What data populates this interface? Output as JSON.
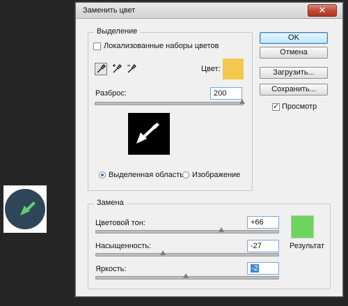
{
  "dialog": {
    "title": "Заменить цвет",
    "close_symbol": "✕"
  },
  "selection": {
    "group_title": "Выделение",
    "localized_clusters_label": "Локализованные наборы цветов",
    "localized_clusters_checked": false,
    "color_label": "Цвет:",
    "color_hex": "#f2c94c",
    "fuzziness_label": "Разброс:",
    "fuzziness_value": "200",
    "fuzziness_level": 1.0,
    "radio_selection_label": "Выделенная область",
    "radio_image_label": "Изображение",
    "radio_selected": "selection"
  },
  "replacement": {
    "group_title": "Замена",
    "hue_label": "Цветовой тон:",
    "hue_value": "+66",
    "hue_level": 0.68,
    "saturation_label": "Насыщенность:",
    "saturation_value": "-27",
    "saturation_level": 0.37,
    "lightness_label": "Яркость:",
    "lightness_value": "-2",
    "lightness_level": 0.49,
    "result_label": "Результат",
    "result_hex": "#6ed460"
  },
  "buttons": {
    "ok": "OK",
    "cancel": "Отмена",
    "load": "Загрузить...",
    "save": "Сохранить..."
  },
  "preview_toggle": {
    "label": "Просмотр",
    "checked": true
  },
  "colors": {
    "thumbnail_bg": "#2e4658",
    "trowel_green": "#5fcf6e"
  }
}
